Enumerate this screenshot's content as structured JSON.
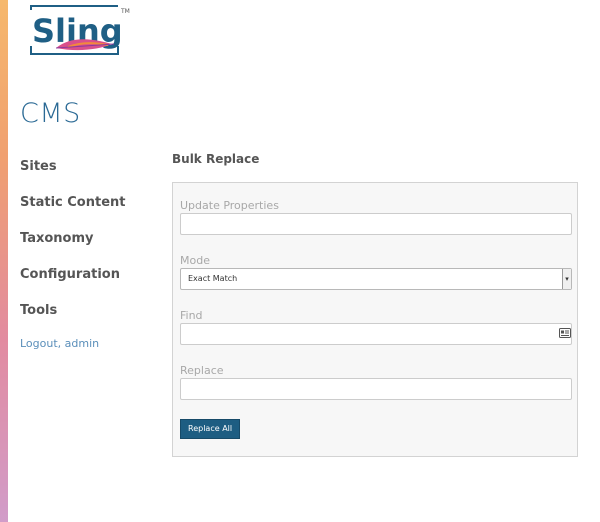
{
  "brand": {
    "logo_text": "Sling",
    "trademark": "TM",
    "accent_color": "#2b6a95"
  },
  "app": {
    "title": "CMS"
  },
  "sidebar": {
    "items": [
      {
        "label": "Sites"
      },
      {
        "label": "Static Content"
      },
      {
        "label": "Taxonomy"
      },
      {
        "label": "Configuration"
      },
      {
        "label": "Tools"
      }
    ],
    "logout_label": "Logout, admin"
  },
  "main": {
    "title": "Bulk Replace",
    "form": {
      "update_properties": {
        "label": "Update Properties",
        "value": ""
      },
      "mode": {
        "label": "Mode",
        "value": "Exact Match"
      },
      "find": {
        "label": "Find",
        "value": ""
      },
      "replace": {
        "label": "Replace",
        "value": ""
      },
      "submit_label": "Replace All"
    }
  },
  "colors": {
    "primary_button": "#1d5d82",
    "nav_text": "#555555",
    "link": "#5b8fba"
  }
}
